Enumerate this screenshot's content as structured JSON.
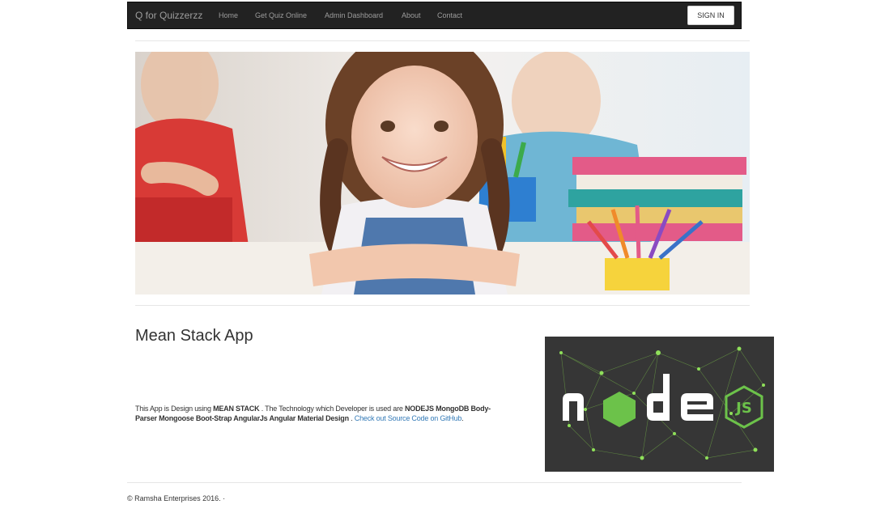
{
  "navbar": {
    "brand": "Q for Quizzerzz",
    "links": [
      "Home",
      "Get Quiz Online",
      "Admin Dashboard",
      "About",
      "Contact"
    ],
    "signin_label": "SIGN IN"
  },
  "main": {
    "title": "Mean Stack App",
    "desc": {
      "p1": "This App is Design using ",
      "b1": "MEAN STACK",
      "p2": " . The Technology which Developer is used are ",
      "b2": "NODEJS MongoDB Body-Parser Mongoose Boot-Strap AngularJs Angular Material Design",
      "p3": " . ",
      "link": "Check out Source Code on GitHub",
      "p4": "."
    }
  },
  "footer": {
    "text": "© Ramsha Enterprises 2016. ·"
  },
  "colors": {
    "navbar_bg": "#222222",
    "nav_text": "#9d9d9d",
    "link": "#337ab7",
    "node_green": "#7cc24a"
  }
}
